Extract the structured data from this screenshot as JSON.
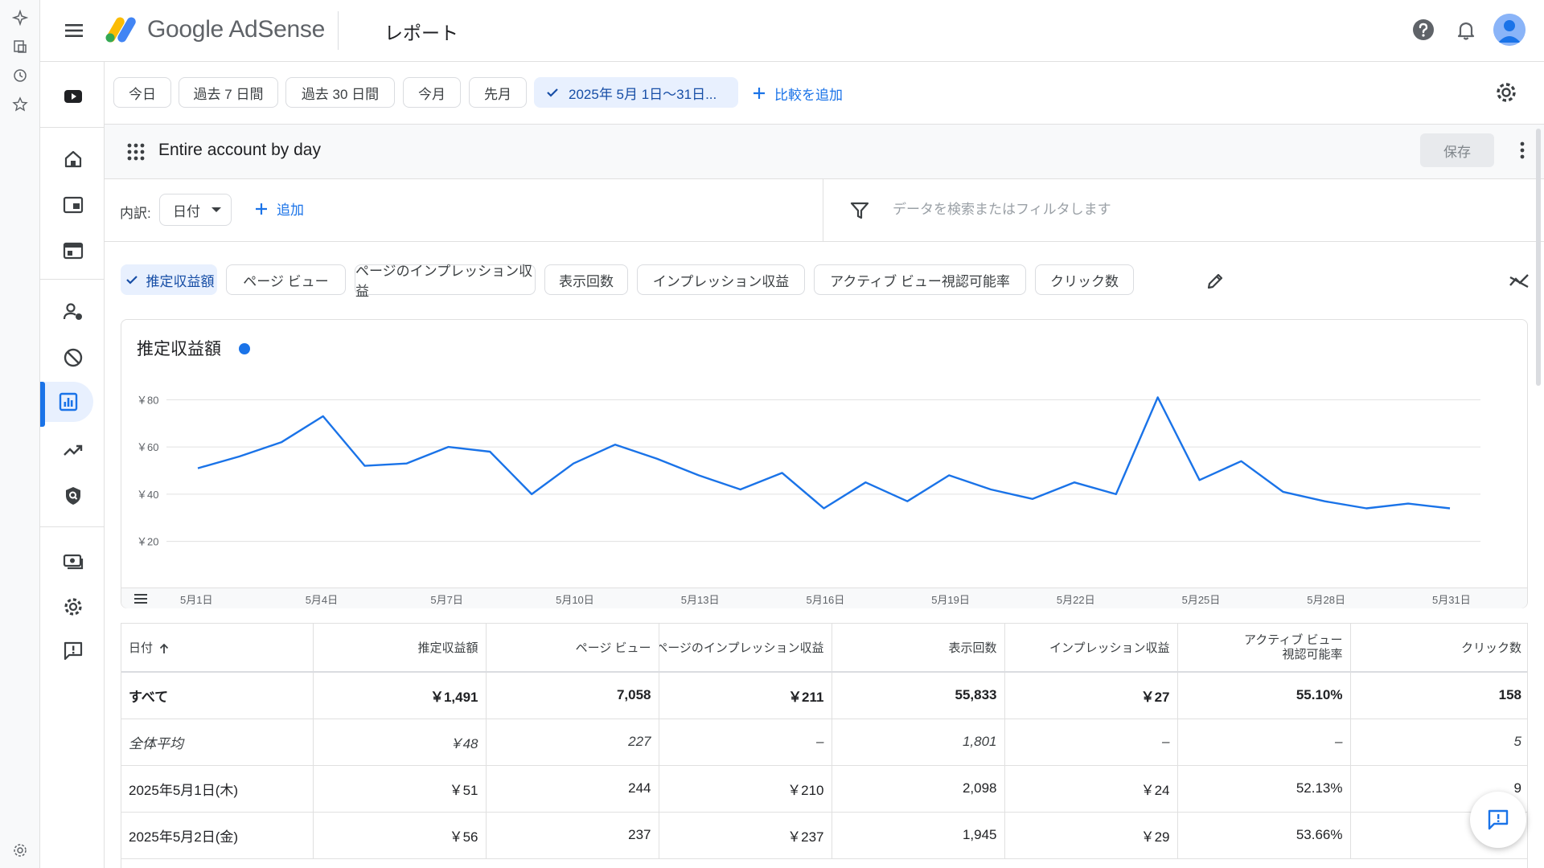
{
  "app": {
    "product_name": "Google AdSense",
    "page_title": "レポート"
  },
  "date_range": {
    "chips": [
      {
        "label": "今日"
      },
      {
        "label": "過去 7 日間"
      },
      {
        "label": "過去 30 日間"
      },
      {
        "label": "今月"
      },
      {
        "label": "先月"
      }
    ],
    "selected_label": "2025年 5月 1日～31日...",
    "add_compare": "比較を追加"
  },
  "report": {
    "name": "Entire account by day",
    "save_label": "保存"
  },
  "breakdown": {
    "label": "内訳:",
    "selected": "日付",
    "add_label": "追加",
    "filter_placeholder": "データを検索またはフィルタします"
  },
  "metrics": [
    {
      "label": "推定収益額",
      "selected": true
    },
    {
      "label": "ページ ビュー",
      "selected": false
    },
    {
      "label": "ページのインプレッション収益",
      "selected": false
    },
    {
      "label": "表示回数",
      "selected": false
    },
    {
      "label": "インプレッション収益",
      "selected": false
    },
    {
      "label": "アクティブ ビュー視認可能率",
      "selected": false
    },
    {
      "label": "クリック数",
      "selected": false
    }
  ],
  "colors": {
    "accent": "#1a73e8",
    "series": "#1a73e8"
  },
  "chart_data": {
    "type": "line",
    "title": "推定収益額",
    "x": [
      "5月1日",
      "5月2日",
      "5月3日",
      "5月4日",
      "5月5日",
      "5月6日",
      "5月7日",
      "5月8日",
      "5月9日",
      "5月10日",
      "5月11日",
      "5月12日",
      "5月13日",
      "5月14日",
      "5月15日",
      "5月16日",
      "5月17日",
      "5月18日",
      "5月19日",
      "5月20日",
      "5月21日",
      "5月22日",
      "5月23日",
      "5月24日",
      "5月25日",
      "5月26日",
      "5月27日",
      "5月28日",
      "5月29日",
      "5月30日",
      "5月31日"
    ],
    "x_tick_labels": [
      "5月1日",
      "5月4日",
      "5月7日",
      "5月10日",
      "5月13日",
      "5月16日",
      "5月19日",
      "5月22日",
      "5月25日",
      "5月28日",
      "5月31日"
    ],
    "y_tick_labels": [
      "￥80",
      "￥60",
      "￥40",
      "￥20"
    ],
    "y_ticks": [
      80,
      60,
      40,
      20
    ],
    "ylim": [
      20,
      80
    ],
    "series": [
      {
        "name": "推定収益額",
        "values": [
          51,
          56,
          62,
          73,
          52,
          53,
          60,
          58,
          40,
          53,
          61,
          55,
          48,
          42,
          49,
          34,
          45,
          37,
          48,
          42,
          38,
          45,
          40,
          81,
          46,
          54,
          41,
          37,
          34,
          36,
          34
        ]
      }
    ],
    "grid": true
  },
  "table": {
    "columns": [
      "日付",
      "推定収益額",
      "ページ ビュー",
      "ページのインプレッション収益",
      "表示回数",
      "インプレッション収益",
      "アクティブ ビュー視認可能率",
      "クリック数"
    ],
    "total_row": [
      "すべて",
      "￥1,491",
      "7,058",
      "￥211",
      "55,833",
      "￥27",
      "55.10%",
      "158"
    ],
    "avg_row": [
      "全体平均",
      "￥48",
      "227",
      "–",
      "1,801",
      "–",
      "–",
      "5"
    ],
    "rows": [
      [
        "2025年5月1日(木)",
        "￥51",
        "244",
        "￥210",
        "2,098",
        "￥24",
        "52.13%",
        "9"
      ],
      [
        "2025年5月2日(金)",
        "￥56",
        "237",
        "￥237",
        "1,945",
        "￥29",
        "53.66%",
        ""
      ]
    ]
  }
}
